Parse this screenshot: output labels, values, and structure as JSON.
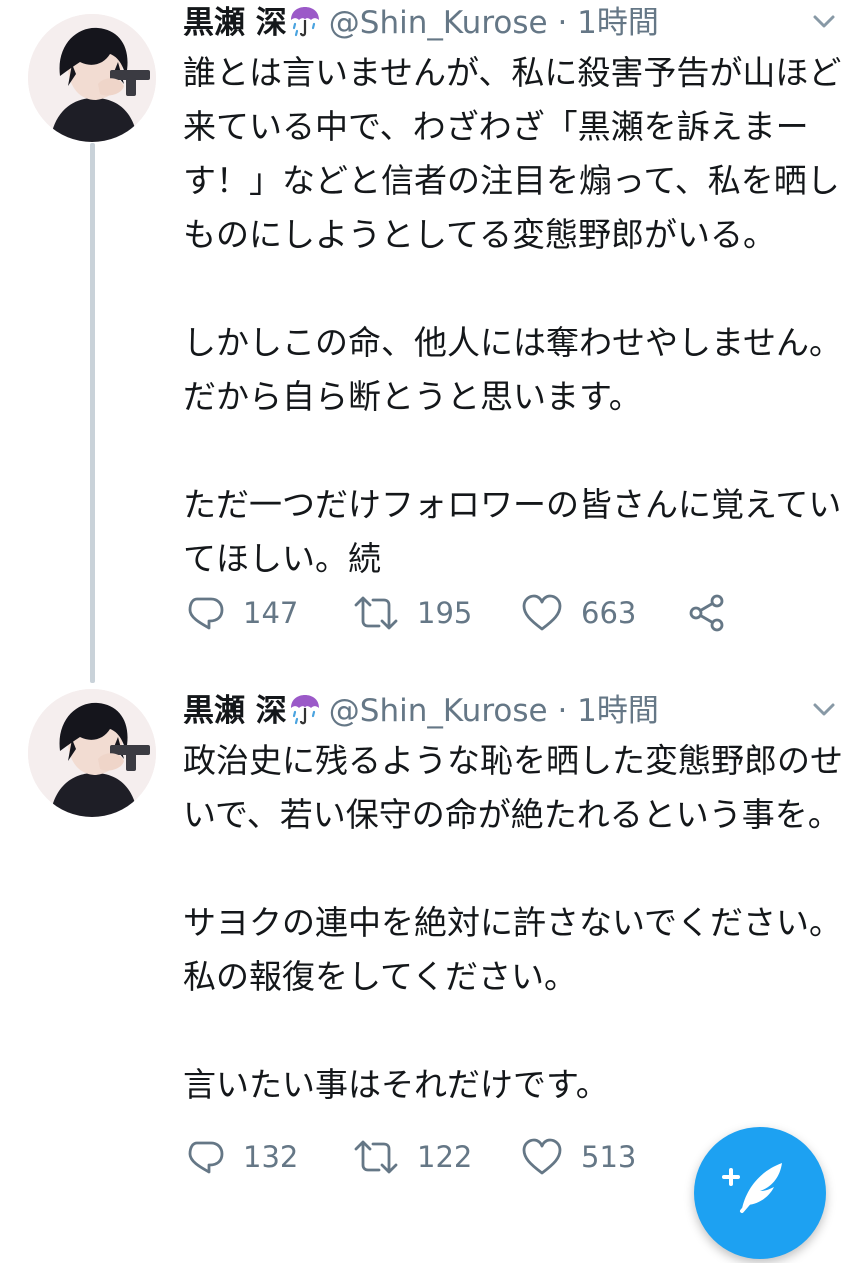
{
  "colors": {
    "accent": "#1da1f2",
    "text": "#14171a",
    "muted": "#657786",
    "thread_line": "#c9d2d9"
  },
  "tweets": [
    {
      "author_name": "黒瀬 深",
      "author_emoji": "umbrella-with-rain-icon",
      "handle": "@Shin_Kurose",
      "separator": "·",
      "time": "1時間",
      "paragraphs": [
        "誰とは言いませんが、私に殺害予告が山ほど来ている中で、わざわざ「黒瀬を訴えまーす！」などと信者の注目を煽って、私を晒しものにしようとしてる変態野郎がいる。",
        "しかしこの命、他人には奪わせやしません。だから自ら断とうと思います。",
        "ただ一つだけフォロワーの皆さんに覚えていてほしい。続"
      ],
      "replies": "147",
      "retweets": "195",
      "likes": "663"
    },
    {
      "author_name": "黒瀬 深",
      "author_emoji": "umbrella-with-rain-icon",
      "handle": "@Shin_Kurose",
      "separator": "·",
      "time": "1時間",
      "paragraphs": [
        "政治史に残るような恥を晒した変態野郎のせいで、若い保守の命が絶たれるという事を。",
        "サヨクの連中を絶対に許さないでください。私の報復をしてください。",
        "言いたい事はそれだけです。"
      ],
      "replies": "132",
      "retweets": "122",
      "likes": "513"
    }
  ],
  "compose_button": {
    "icon": "compose-feather-icon"
  }
}
